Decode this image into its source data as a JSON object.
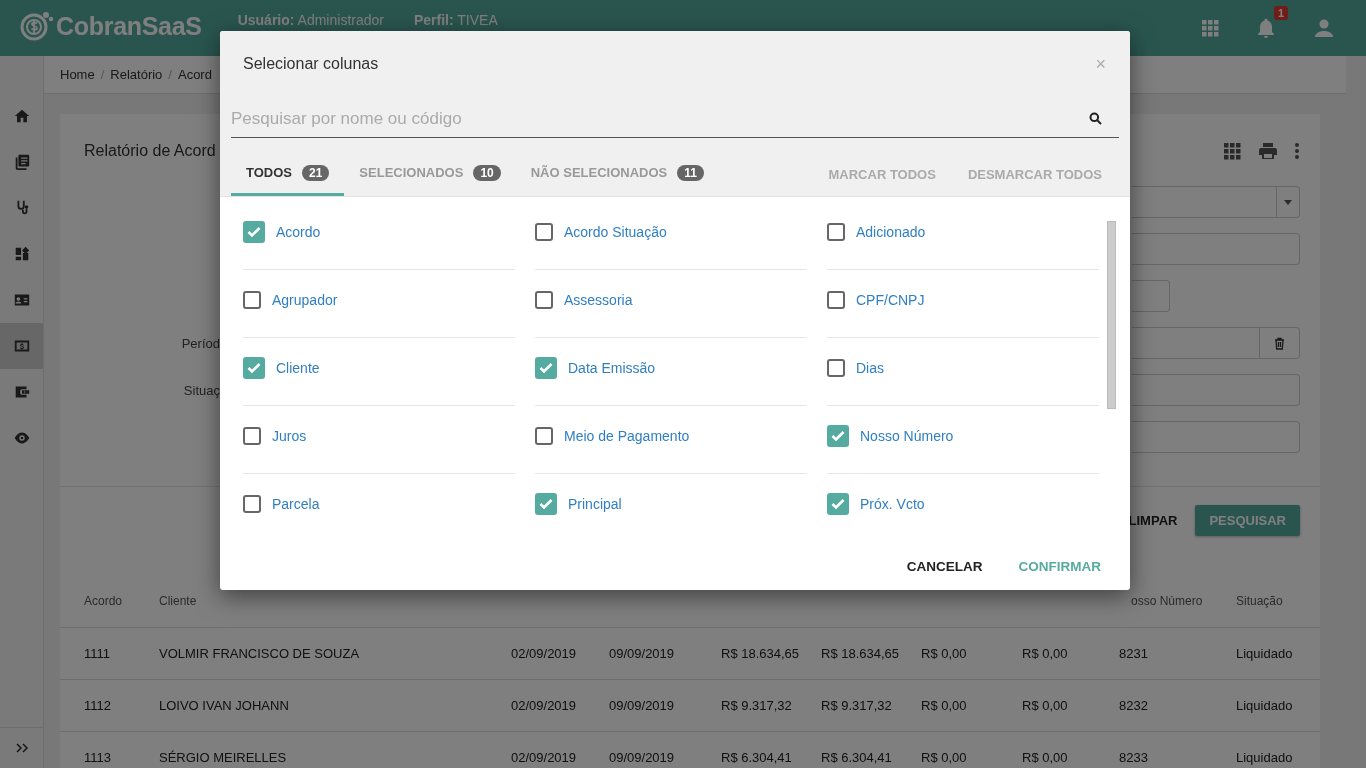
{
  "header": {
    "logo": "CobranSaaS",
    "user_label": "Usuário:",
    "user": "Administrador",
    "profile_label": "Perfil:",
    "profile": "TIVEA",
    "notifications": "1"
  },
  "sidebar": {
    "items": [
      {
        "selected": false
      },
      {
        "selected": false
      },
      {
        "selected": false
      },
      {
        "selected": false
      },
      {
        "selected": false
      },
      {
        "selected": true
      },
      {
        "selected": false
      },
      {
        "selected": false
      }
    ]
  },
  "breadcrumb": {
    "separator": "/",
    "items": [
      "Home",
      "Relatório",
      "Acord"
    ]
  },
  "report": {
    "title": "Relatório de Acord",
    "filters": [
      {
        "kind": "select"
      },
      {
        "kind": "text"
      },
      {
        "kind": "short"
      },
      {
        "kind": "range",
        "label": "Períod"
      },
      {
        "kind": "text",
        "label": "Situaç"
      },
      {
        "kind": "text"
      }
    ],
    "actions": [
      {
        "label": "LIMPAR",
        "kind": "flat"
      },
      {
        "label": "PESQUISAR",
        "kind": "raised"
      }
    ]
  },
  "table": {
    "columns": [
      "Acordo",
      "Cliente",
      null,
      null,
      null,
      null,
      null,
      null,
      "osso Número",
      "Situação"
    ],
    "rows": [
      [
        "1111",
        "VOLMIR FRANCISCO DE SOUZA",
        "02/09/2019",
        "09/09/2019",
        "R$ 18.634,65",
        "R$ 18.634,65",
        "R$ 0,00",
        "R$ 0,00",
        "8231",
        "Liquidado"
      ],
      [
        "1112",
        "LOIVO IVAN JOHANN",
        "02/09/2019",
        "09/09/2019",
        "R$ 9.317,32",
        "R$ 9.317,32",
        "R$ 0,00",
        "R$ 0,00",
        "8232",
        "Liquidado"
      ],
      [
        "1113",
        "SÉRGIO MEIRELLES",
        "02/09/2019",
        "09/09/2019",
        "R$ 6.304,41",
        "R$ 6.304,41",
        "R$ 0,00",
        "R$ 0,00",
        "8233",
        "Liquidado"
      ]
    ]
  },
  "dialog": {
    "title": "Selecionar colunas",
    "close": "×",
    "search": {
      "placeholder": "Pesquisar por nome ou código"
    },
    "tabs": [
      {
        "label": "TODOS",
        "count": "21",
        "selected": true
      },
      {
        "label": "SELECIONADOS",
        "count": "10",
        "selected": false
      },
      {
        "label": "NÃO SELECIONADOS",
        "count": "11",
        "selected": false
      }
    ],
    "bulk_actions": [
      "MARCAR TODOS",
      "DESMARCAR TODOS"
    ],
    "columns": [
      {
        "label": "Acordo",
        "checked": true
      },
      {
        "label": "Acordo Situação",
        "checked": false
      },
      {
        "label": "Adicionado",
        "checked": false
      },
      {
        "label": "Agrupador",
        "checked": false
      },
      {
        "label": "Assessoria",
        "checked": false
      },
      {
        "label": "CPF/CNPJ",
        "checked": false
      },
      {
        "label": "Cliente",
        "checked": true
      },
      {
        "label": "Data Emissão",
        "checked": true
      },
      {
        "label": "Dias",
        "checked": false
      },
      {
        "label": "Juros",
        "checked": false
      },
      {
        "label": "Meio de Pagamento",
        "checked": false
      },
      {
        "label": "Nosso Número",
        "checked": true
      },
      {
        "label": "Parcela",
        "checked": false
      },
      {
        "label": "Principal",
        "checked": true
      },
      {
        "label": "Próx. Vcto",
        "checked": true
      }
    ],
    "buttons": [
      {
        "label": "CANCELAR",
        "kind": "plain"
      },
      {
        "label": "CONFIRMAR",
        "kind": "primary"
      }
    ]
  }
}
